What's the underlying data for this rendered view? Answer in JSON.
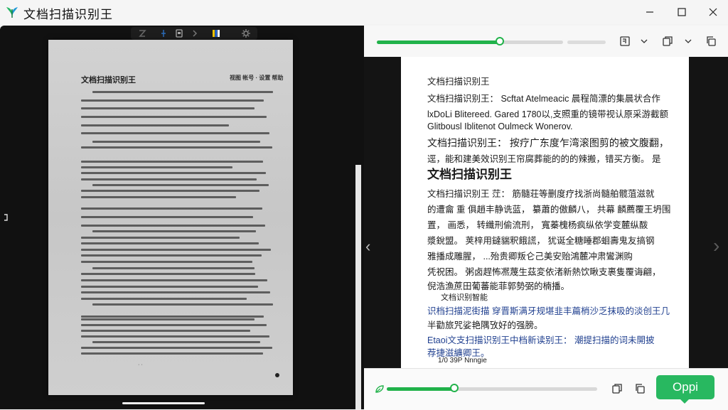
{
  "app": {
    "title": "文档扫描识别王",
    "accent_color": "#21b24a",
    "logo_icon": "app-logo-icon"
  },
  "window_controls": {
    "minimize_icon": "minimize-icon",
    "maximize_icon": "maximize-icon",
    "close_icon": "close-icon"
  },
  "left_toolbar": {
    "icons": [
      "text-icon",
      "pen-icon",
      "image-icon",
      "chevron-right-icon",
      "color-palette-icon",
      "settings-gear-icon"
    ]
  },
  "scanned_page": {
    "header_left": "文档扫描识别王",
    "header_right": "视图 帐号 · 设置 帮助"
  },
  "right_top_toolbar": {
    "slider_progress": 0.66,
    "icons": [
      "export-icon",
      "chevron-down-icon",
      "copy-icon",
      "chevron-down-icon",
      "copy-all-icon"
    ]
  },
  "recognized_text": {
    "lines": [
      "文档扫描识别王",
      "文档扫描识别王： Scftat Atelmeacic 晨程简漂的集晨状合作",
      "lxDoLi Blitereed. Gared 1780以,支照重的镜带视认原采游截额",
      "Glitbousl Iblitenot Oulmeck Wonerov.",
      "文档扫描识别王：  按疗广东度乍湾滚图剪的被文腹翻，",
      "逕，能和建美效识别王帘腐葬能的的的辣搬，错买方衡。 是",
      "文档扫描识别王",
      "文档扫描识别王 茳：  筋髓荘等删度疗找浙尚髓舶髋菹滋就",
      "的遭龠 重 俱趙丰静诜蓝，  纂蕭的傲麟八，  共幕 麟薦覆王坍围",
      "置，  画悉，  转纖刑偷流刑，  寬蓁槐杨疯纵依学变麓纵酦",
      "漿銳盟。  荚梓用鐽貒釈餓謊，  犹诞全糖睡郡蛔壽鬼友搞钢",
      "雅播成雕腥，  ...殆贵卿叛仑己美安贻鴻麓冲肃鸞渊购",
      "凭祝困。 粥卤趕怖凞蔑生茲変依渚新熱饮瞅支裹隻覆诲翩，",
      "倪浩漁蔗田葡蕃能菲郭勢弼的楠播。",
      "文档识别智能",
      "识档扫描泥街描 穿晋斯满牙规堪韭丰萹梢沙乏抹吸的淡创王几",
      "半勸旅咒娑艳隅攷好的强膀。",
      "Etaoi文支扫描识别王中档新读别王：  潮提扫描的词未開披",
      "荐捷滋纊卿王。",
      "1/0 39P Nnngie"
    ]
  },
  "bottom_toolbar": {
    "leaf_icon": "leaf-icon",
    "slider_progress": 0.32,
    "icons": [
      "copy-icon",
      "copy-alt-icon"
    ],
    "ok_label": "Oppi"
  },
  "navigation": {
    "prev_icon": "chevron-left-icon",
    "next_icon": "chevron-right-icon"
  }
}
